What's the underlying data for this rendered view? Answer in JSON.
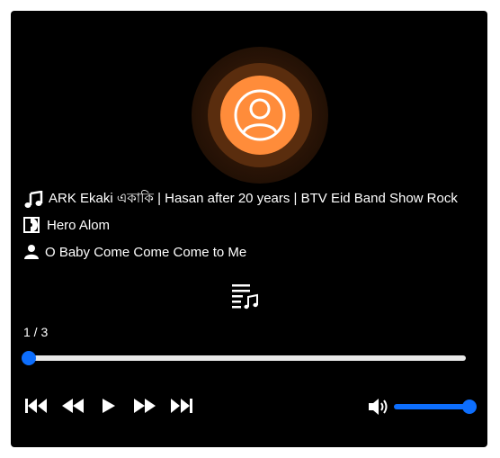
{
  "track": {
    "title": "ARK Ekaki একাকি | Hasan after 20 years | BTV Eid Band Show Rock",
    "album": "Hero Alom",
    "artist": "O Baby Come Come Come to Me"
  },
  "playlist": {
    "position_label": "1 / 3"
  },
  "progress": {
    "fraction": 0.0
  },
  "volume": {
    "fraction": 1.0
  },
  "colors": {
    "accent": "#0d6efd",
    "cover": "#ff8c3a",
    "background": "#000000"
  },
  "icons": {
    "cover": "user-circle-icon",
    "title": "music-note-icon",
    "album": "record-icon",
    "artist": "person-icon",
    "playlist": "playlist-icon",
    "prev": "skip-back-icon",
    "rewind": "rewind-icon",
    "play": "play-icon",
    "forward": "fast-forward-icon",
    "next": "skip-forward-icon",
    "volume": "volume-icon"
  }
}
